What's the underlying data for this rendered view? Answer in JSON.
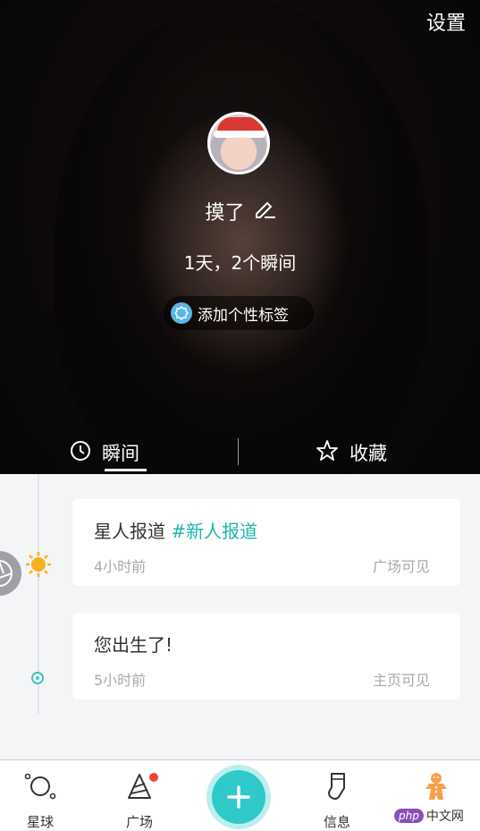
{
  "header": {
    "settings_label": "设置"
  },
  "profile": {
    "name": "摸了",
    "stats": "1天，2个瞬间",
    "tag_button_label": "添加个性标签"
  },
  "tabs": [
    {
      "label": "瞬间",
      "active": true,
      "icon": "clock-icon"
    },
    {
      "label": "收藏",
      "active": false,
      "icon": "star-icon"
    }
  ],
  "moments": [
    {
      "title": "星人报道",
      "hashtag": "#新人报道",
      "time": "4小时前",
      "visibility": "广场可见",
      "marker": "sun-icon"
    },
    {
      "title": "您出生了!",
      "time": "5小时前",
      "visibility": "主页可见",
      "marker": "dot-icon"
    }
  ],
  "nav": {
    "planet_label": "星球",
    "square_label": "广场",
    "messages_label": "信息",
    "add_icon": "plus-icon",
    "me_icon": "gingerbread-icon",
    "square_has_badge": true
  },
  "watermark": {
    "logo": "php",
    "text": "中文网"
  },
  "colors": {
    "accent": "#2ec9c8",
    "hashtag": "#1db5a9",
    "badge": "#f44336"
  }
}
